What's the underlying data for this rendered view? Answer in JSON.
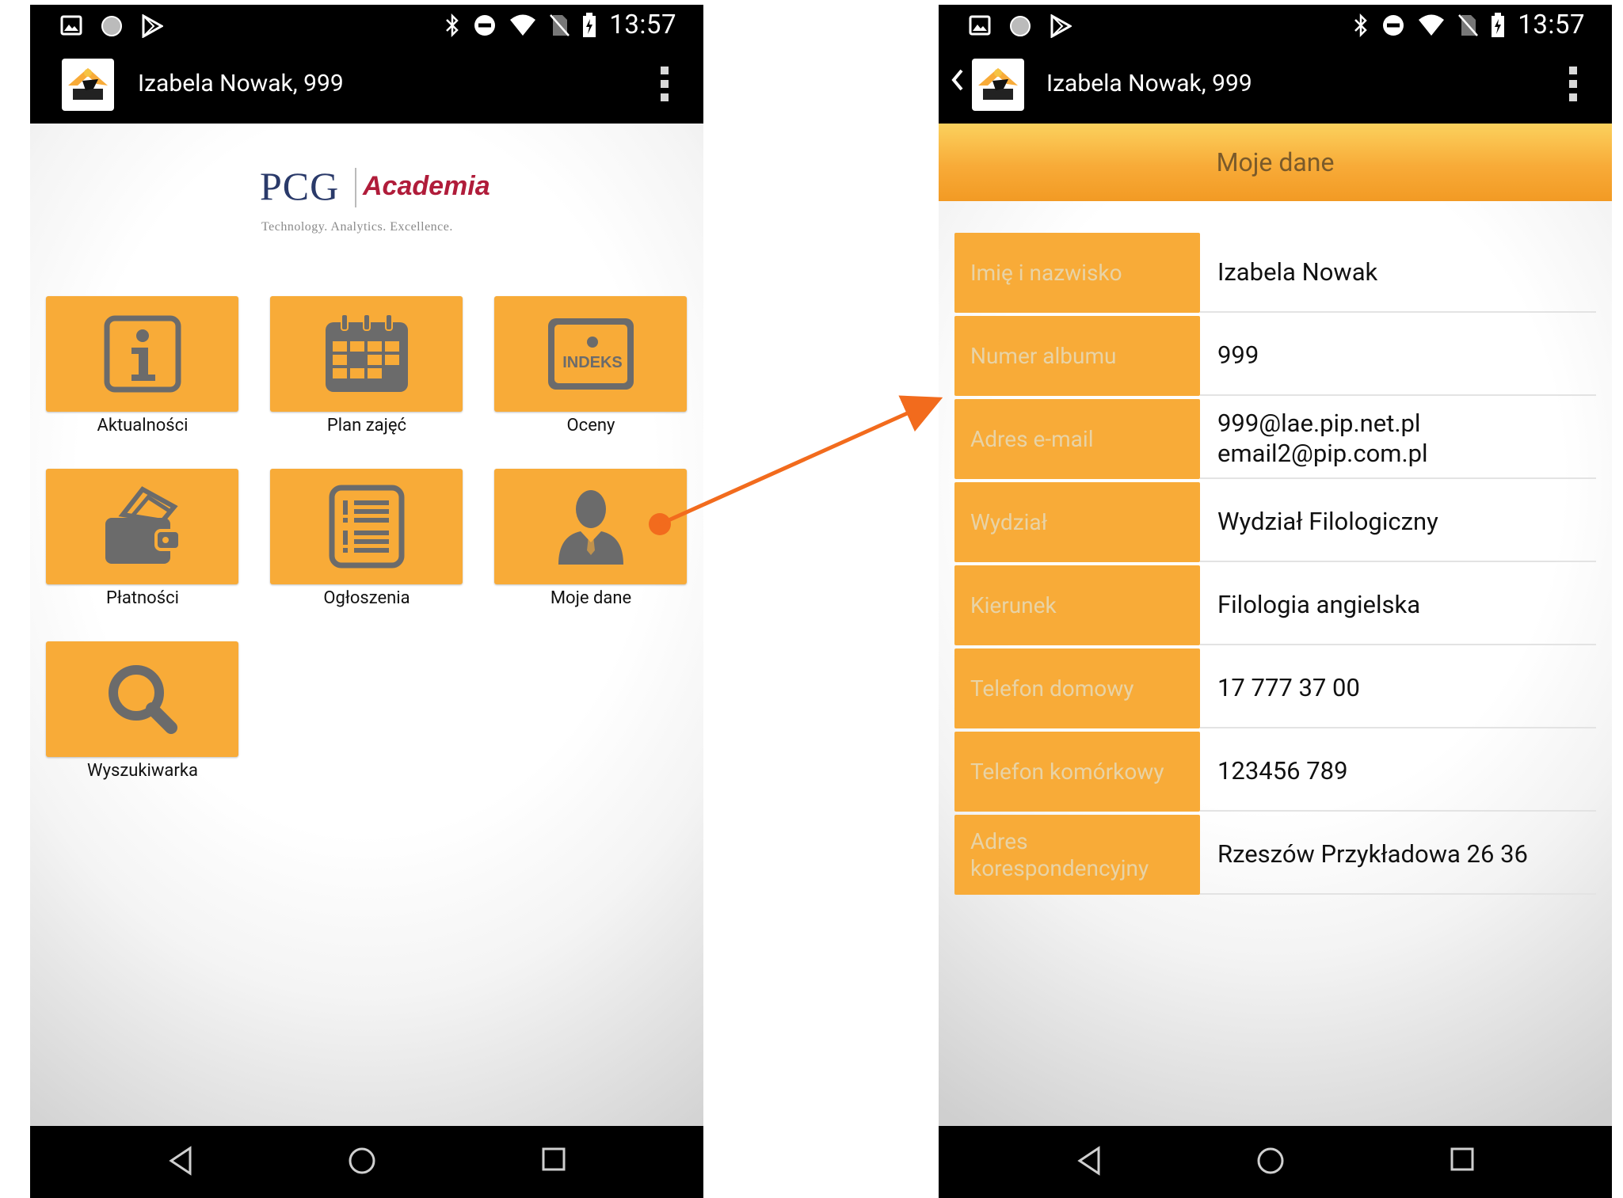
{
  "status_bar": {
    "time": "13:57"
  },
  "app_bar": {
    "title": "Izabela Nowak, 999"
  },
  "logo": {
    "brand": "PCG",
    "product": "Academia",
    "tagline": "Technology. Analytics. Excellence."
  },
  "menu": {
    "tiles": [
      {
        "label": "Aktualności",
        "icon": "info-icon"
      },
      {
        "label": "Plan zajęć",
        "icon": "calendar-icon"
      },
      {
        "label": "Oceny",
        "icon": "index-book-icon",
        "icon_text": "INDEKS"
      },
      {
        "label": "Płatności",
        "icon": "wallet-icon"
      },
      {
        "label": "Ogłoszenia",
        "icon": "announcements-icon"
      },
      {
        "label": "Moje dane",
        "icon": "user-icon"
      },
      {
        "label": "Wyszukiwarka",
        "icon": "search-icon"
      }
    ]
  },
  "details": {
    "header": "Moje dane",
    "rows": [
      {
        "label": "Imię i nazwisko",
        "value": [
          "Izabela Nowak"
        ]
      },
      {
        "label": "Numer albumu",
        "value": [
          "999"
        ]
      },
      {
        "label": "Adres e-mail",
        "value": [
          "999@lae.pip.net.pl",
          "email2@pip.com.pl"
        ]
      },
      {
        "label": "Wydział",
        "value": [
          "Wydział Filologiczny"
        ]
      },
      {
        "label": "Kierunek",
        "value": [
          "Filologia angielska"
        ]
      },
      {
        "label": "Telefon domowy",
        "value": [
          "17 777 37 00"
        ]
      },
      {
        "label": "Telefon komórkowy",
        "value": [
          "123456 789"
        ]
      },
      {
        "label": "Adres korespondencyjny",
        "value": [
          "Rzeszów Przykładowa 26 36"
        ]
      }
    ]
  },
  "colors": {
    "tile": "#f8ab38",
    "arrow": "#f26b1d",
    "label_text": "#e8d3a6"
  }
}
